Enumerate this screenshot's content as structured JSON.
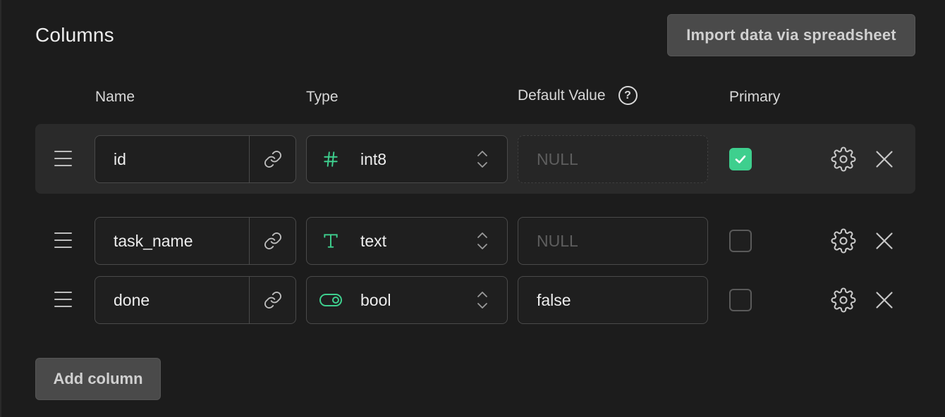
{
  "title": "Columns",
  "import_button": "Import data via spreadsheet",
  "headers": {
    "name": "Name",
    "type": "Type",
    "default_value": "Default Value",
    "primary": "Primary"
  },
  "rows": [
    {
      "name": "id",
      "type": "int8",
      "type_icon": "hash-icon",
      "default_value": "",
      "default_placeholder": "NULL",
      "primary": true
    },
    {
      "name": "task_name",
      "type": "text",
      "type_icon": "text-type-icon",
      "default_value": "",
      "default_placeholder": "NULL",
      "primary": false
    },
    {
      "name": "done",
      "type": "bool",
      "type_icon": "toggle-icon",
      "default_value": "false",
      "default_placeholder": "",
      "primary": false
    }
  ],
  "add_button": "Add column",
  "colors": {
    "accent": "#3ecf8e",
    "background": "#1c1c1c"
  }
}
